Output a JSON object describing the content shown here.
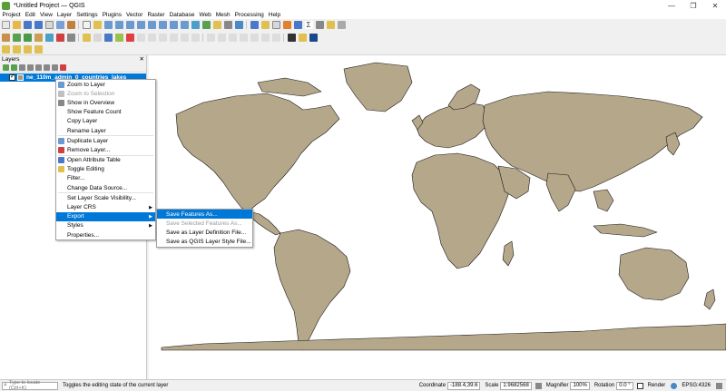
{
  "window": {
    "title": "*Untitled Project — QGIS",
    "controls": [
      "—",
      "❐",
      "✕"
    ]
  },
  "menubar": [
    "Project",
    "Edit",
    "View",
    "Layer",
    "Settings",
    "Plugins",
    "Vector",
    "Raster",
    "Database",
    "Web",
    "Mesh",
    "Processing",
    "Help"
  ],
  "layers_panel": {
    "title": "Layers",
    "close": "✕",
    "layer_name": "ne_110m_admin_0_countries_lakes"
  },
  "context_menu": {
    "items": [
      {
        "label": "Zoom to Layer",
        "disabled": false
      },
      {
        "label": "Zoom to Selection",
        "disabled": true
      },
      {
        "label": "Show in Overview",
        "disabled": false
      },
      {
        "label": "Show Feature Count",
        "disabled": false
      },
      {
        "label": "Copy Layer",
        "disabled": false
      },
      {
        "label": "Rename Layer",
        "disabled": false
      },
      {
        "label": "Duplicate Layer",
        "disabled": false
      },
      {
        "label": "Remove Layer...",
        "disabled": false
      },
      {
        "label": "Open Attribute Table",
        "disabled": false
      },
      {
        "label": "Toggle Editing",
        "disabled": false
      },
      {
        "label": "Filter...",
        "disabled": false
      },
      {
        "label": "Change Data Source...",
        "disabled": false
      },
      {
        "label": "Set Layer Scale Visibility...",
        "disabled": false
      },
      {
        "label": "Layer CRS",
        "disabled": false
      },
      {
        "label": "Export",
        "disabled": false
      },
      {
        "label": "Styles",
        "disabled": false
      },
      {
        "label": "Properties...",
        "disabled": false
      }
    ]
  },
  "export_submenu": {
    "items": [
      {
        "label": "Save Features As...",
        "disabled": false
      },
      {
        "label": "Save Selected Features As...",
        "disabled": true
      },
      {
        "label": "Save as Layer Definition File...",
        "disabled": false
      },
      {
        "label": "Save as QGIS Layer Style File...",
        "disabled": false
      }
    ]
  },
  "statusbar": {
    "locate_placeholder": "Type to locate (Ctrl+K)",
    "message": "Toggles the editing state of the current layer",
    "coordinate_label": "Coordinate",
    "coordinate": "-188.4,39.6",
    "scale_label": "Scale",
    "scale": "1:9682568",
    "magnifier_label": "Magnifier",
    "magnifier": "100%",
    "rotation_label": "Rotation",
    "rotation": "0.0 °",
    "render_label": "Render",
    "crs": "EPSG:4326"
  },
  "colors": {
    "land": "#b4a78a",
    "selection": "#0078d7",
    "app_icon": "#5a9e3a"
  }
}
